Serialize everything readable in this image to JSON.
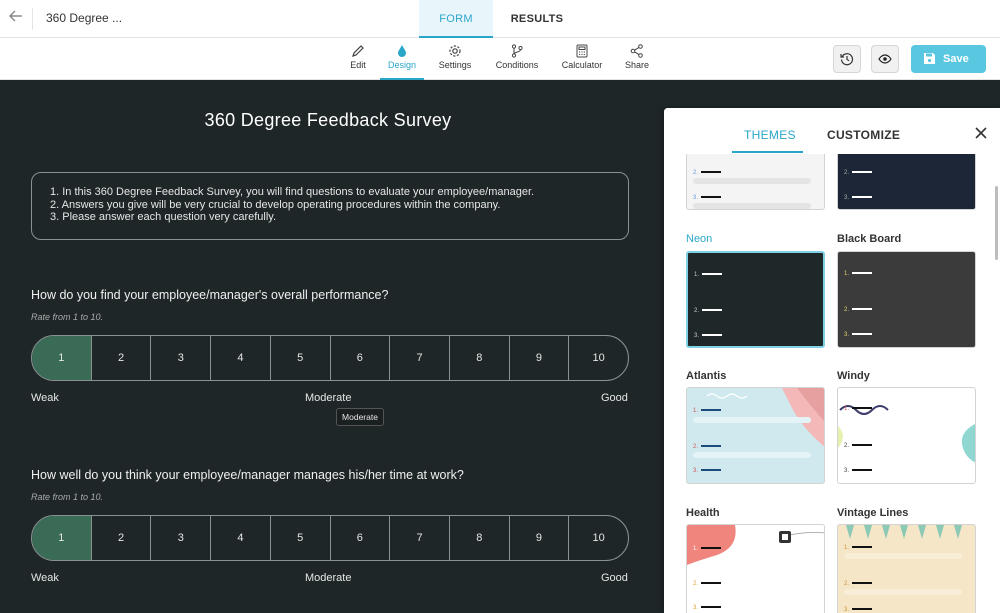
{
  "header": {
    "form_title": "360 Degree ...",
    "tabs": {
      "form": "FORM",
      "results": "RESULTS"
    }
  },
  "toolbar": {
    "items": [
      {
        "label": "Edit",
        "icon": "pencil-icon"
      },
      {
        "label": "Design",
        "icon": "drop-icon",
        "active": true
      },
      {
        "label": "Settings",
        "icon": "gear-icon"
      },
      {
        "label": "Conditions",
        "icon": "branch-icon"
      },
      {
        "label": "Calculator",
        "icon": "calculator-icon"
      },
      {
        "label": "Share",
        "icon": "share-icon"
      }
    ],
    "save_label": "Save"
  },
  "survey": {
    "title": "360 Degree Feedback Survey",
    "intro": [
      "1. In this 360 Degree Feedback Survey, you will find questions to evaluate your employee/manager.",
      "2. Answers you give will be very crucial to develop operating procedures within the company.",
      "3. Please answer each question very carefully."
    ],
    "questions": [
      {
        "title": "How do you find your employee/manager's overall performance?",
        "subtitle": "Rate from 1 to 10.",
        "options": [
          "1",
          "2",
          "3",
          "4",
          "5",
          "6",
          "7",
          "8",
          "9",
          "10"
        ],
        "selected": "1",
        "low_label": "Weak",
        "mid_label": "Moderate",
        "high_label": "Good"
      },
      {
        "title": "How well do you think your employee/manager manages his/her time at work?",
        "subtitle": "Rate from 1 to 10.",
        "options": [
          "1",
          "2",
          "3",
          "4",
          "5",
          "6",
          "7",
          "8",
          "9",
          "10"
        ],
        "selected": "1",
        "low_label": "Weak",
        "mid_label": "Moderate",
        "high_label": "Good"
      }
    ],
    "tooltip": "Moderate"
  },
  "theme_panel": {
    "tabs": {
      "themes": "THEMES",
      "customize": "CUSTOMIZE"
    },
    "themes": [
      {
        "name": "Neon",
        "selected": true
      },
      {
        "name": "Black Board"
      },
      {
        "name": "Atlantis"
      },
      {
        "name": "Windy"
      },
      {
        "name": "Health"
      },
      {
        "name": "Vintage Lines"
      }
    ]
  },
  "colors": {
    "accent": "#2aa6c9",
    "canvas_bg": "#1e2627",
    "selected_option": "#3a6b57",
    "save_button": "#5ac7e0"
  }
}
